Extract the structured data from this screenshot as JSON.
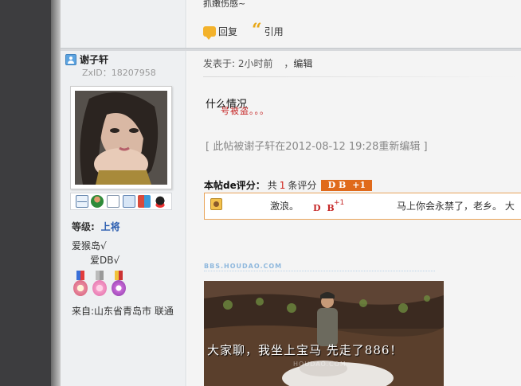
{
  "prev_post": {
    "text": "抓嫩伤感~",
    "reply_label": "回复",
    "quote_label": "引用"
  },
  "author": {
    "name": "谢子轩",
    "zxid": "ZxID：18207958",
    "level_label": "等级:",
    "level_value": "上将",
    "sig_line1": "爱猴岛√",
    "sig_line2": "爱DB√",
    "from": "来自:山东省青岛市 联通",
    "tool_icons": [
      "mail-icon",
      "add-friend-icon",
      "profile-doc-icon",
      "card-icon",
      "blocks-icon",
      "qq-icon"
    ],
    "medals": [
      "medal-cake",
      "medal-heart",
      "medal-badge"
    ]
  },
  "post": {
    "meta_prefix": "发表于: 2小时前",
    "meta_sep": "，",
    "edit_label": "编辑",
    "body": "什么情况",
    "overlay": "号被盗。。。",
    "edit_note": "[ 此帖被谢子轩在2012-08-12 19:28重新编辑 ]",
    "rating": {
      "label": "本帖de评分：",
      "total_prefix": "共",
      "count": "1",
      "total_suffix": "条评分",
      "badge_unit": "D B",
      "badge_value": "+1",
      "note": "激浪。",
      "db": "D B",
      "plus": "+1",
      "reason": "马上你会永禁了，老乡。  大"
    },
    "site_mark": "BBS.HOUDAO.COM",
    "photo_caption": "大家聊，我坐上宝马 先走了886！",
    "photo_sub": "HOUDAO.COM"
  },
  "colors": {
    "gutter": "#3d3d3f",
    "author_bg": "#eef0f2",
    "post_bg": "#f4f4f4",
    "level_blue": "#2a5db0",
    "rating_orange": "#e06a1b",
    "accent_red": "#c62828"
  }
}
